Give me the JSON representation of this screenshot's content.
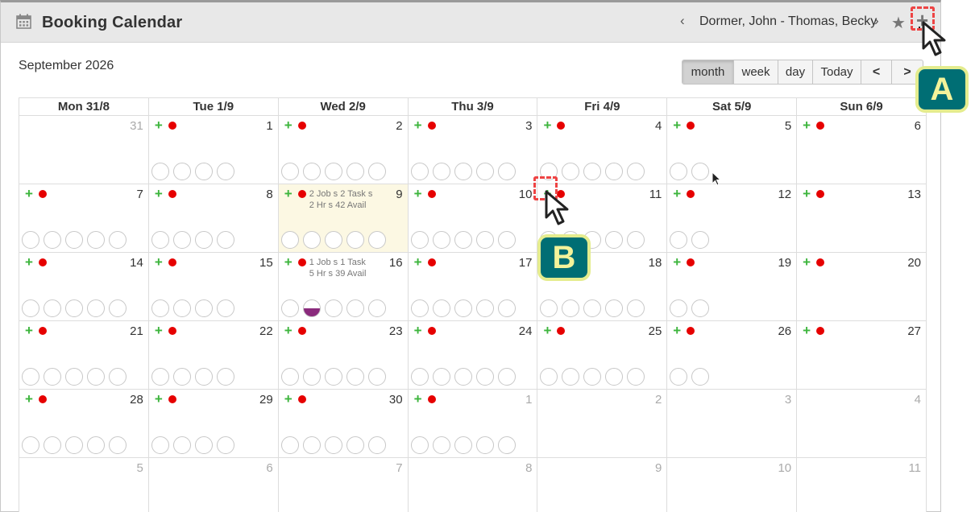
{
  "header": {
    "title": "Booking Calendar",
    "icon": "calendar-icon",
    "people_label": "Dormer, John - Thomas, Becky",
    "prev_glyph": "‹",
    "next_glyph": "›",
    "star_glyph": "★",
    "add_glyph": "+"
  },
  "month_title": "September 2026",
  "views": {
    "month": "month",
    "week": "week",
    "day": "day",
    "today": "Today",
    "prev": "<",
    "next": ">",
    "active": "month"
  },
  "day_headers": [
    "Mon 31/8",
    "Tue 1/9",
    "Wed 2/9",
    "Thu 3/9",
    "Fri 4/9",
    "Sat 5/9",
    "Sun 6/9"
  ],
  "weeks": [
    [
      {
        "num": "31",
        "other": true,
        "actions": false,
        "slots": 0
      },
      {
        "num": "1",
        "other": false,
        "actions": true,
        "slots": 4
      },
      {
        "num": "2",
        "other": false,
        "actions": true,
        "slots": 5
      },
      {
        "num": "3",
        "other": false,
        "actions": true,
        "slots": 5
      },
      {
        "num": "4",
        "other": false,
        "actions": true,
        "slots": 5
      },
      {
        "num": "5",
        "other": false,
        "actions": true,
        "slots": 2
      },
      {
        "num": "6",
        "other": false,
        "actions": true,
        "slots": 0
      }
    ],
    [
      {
        "num": "7",
        "other": false,
        "actions": true,
        "slots": 5
      },
      {
        "num": "8",
        "other": false,
        "actions": true,
        "slots": 4
      },
      {
        "num": "9",
        "other": false,
        "actions": true,
        "slots": 5,
        "highlight": true,
        "summary": [
          "2 Job s 2 Task s",
          "2 Hr s 42 Avail"
        ]
      },
      {
        "num": "10",
        "other": false,
        "actions": true,
        "slots": 5
      },
      {
        "num": "11",
        "other": false,
        "actions": true,
        "slots": 5
      },
      {
        "num": "12",
        "other": false,
        "actions": true,
        "slots": 2
      },
      {
        "num": "13",
        "other": false,
        "actions": true,
        "slots": 0
      }
    ],
    [
      {
        "num": "14",
        "other": false,
        "actions": true,
        "slots": 5
      },
      {
        "num": "15",
        "other": false,
        "actions": true,
        "slots": 4
      },
      {
        "num": "16",
        "other": false,
        "actions": true,
        "slots": 5,
        "half_slot": 1,
        "summary": [
          "1 Job s 1 Task",
          "5 Hr s 39 Avail"
        ]
      },
      {
        "num": "17",
        "other": false,
        "actions": true,
        "slots": 5
      },
      {
        "num": "18",
        "other": false,
        "actions": true,
        "slots": 5
      },
      {
        "num": "19",
        "other": false,
        "actions": true,
        "slots": 2
      },
      {
        "num": "20",
        "other": false,
        "actions": true,
        "slots": 0
      }
    ],
    [
      {
        "num": "21",
        "other": false,
        "actions": true,
        "slots": 5
      },
      {
        "num": "22",
        "other": false,
        "actions": true,
        "slots": 4
      },
      {
        "num": "23",
        "other": false,
        "actions": true,
        "slots": 5
      },
      {
        "num": "24",
        "other": false,
        "actions": true,
        "slots": 5
      },
      {
        "num": "25",
        "other": false,
        "actions": true,
        "slots": 5
      },
      {
        "num": "26",
        "other": false,
        "actions": true,
        "slots": 2
      },
      {
        "num": "27",
        "other": false,
        "actions": true,
        "slots": 0
      }
    ],
    [
      {
        "num": "28",
        "other": false,
        "actions": true,
        "slots": 5
      },
      {
        "num": "29",
        "other": false,
        "actions": true,
        "slots": 4
      },
      {
        "num": "30",
        "other": false,
        "actions": true,
        "slots": 5
      },
      {
        "num": "1",
        "other": true,
        "actions": true,
        "slots": 5
      },
      {
        "num": "2",
        "other": true,
        "actions": false,
        "slots": 0
      },
      {
        "num": "3",
        "other": true,
        "actions": false,
        "slots": 0
      },
      {
        "num": "4",
        "other": true,
        "actions": false,
        "slots": 0
      }
    ],
    [
      {
        "num": "5",
        "other": true,
        "actions": false,
        "slots": 0
      },
      {
        "num": "6",
        "other": true,
        "actions": false,
        "slots": 0
      },
      {
        "num": "7",
        "other": true,
        "actions": false,
        "slots": 0
      },
      {
        "num": "8",
        "other": true,
        "actions": false,
        "slots": 0
      },
      {
        "num": "9",
        "other": true,
        "actions": false,
        "slots": 0
      },
      {
        "num": "10",
        "other": true,
        "actions": false,
        "slots": 0
      },
      {
        "num": "11",
        "other": true,
        "actions": false,
        "slots": 0
      }
    ]
  ],
  "annotations": {
    "a_label": "A",
    "b_label": "B",
    "badge_color": "#006e74",
    "badge_border": "#e4ec8e",
    "marker_color": "#ee4444"
  },
  "colors": {
    "plus": "#3db53d",
    "dot": "#e60000",
    "highlight": "#fcf8e3",
    "booked": "#8a2a7c"
  }
}
